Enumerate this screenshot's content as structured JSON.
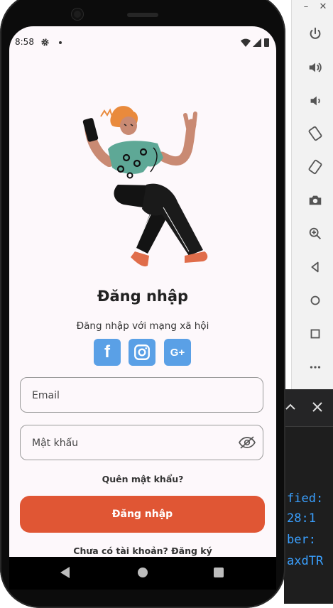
{
  "status_bar": {
    "time": "8:58"
  },
  "login": {
    "title": "Đăng nhập",
    "social_caption": "Đăng nhập với mạng xã hội",
    "social": [
      {
        "name": "facebook",
        "glyph": "f"
      },
      {
        "name": "instagram",
        "glyph": ""
      },
      {
        "name": "google-plus",
        "glyph": "G+"
      }
    ],
    "email_placeholder": "Email",
    "password_placeholder": "Mật khẩu",
    "forgot_password": "Quên mật khẩu?",
    "login_button": "Đăng nhập",
    "register_prompt": "Chưa có tài khoản? Đăng ký"
  },
  "ide_snippet": [
    "fied:",
    "28:1",
    "ber:",
    "axdTR"
  ],
  "colors": {
    "accent": "#e05634",
    "social": "#5aa0e6",
    "screen_bg": "#fdf8fb"
  }
}
